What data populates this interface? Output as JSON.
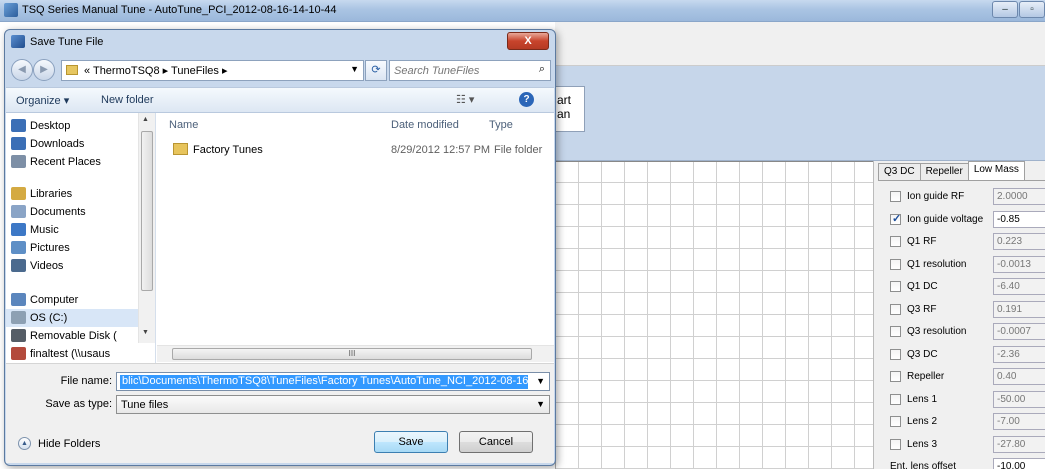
{
  "main_window": {
    "title": "TSQ Series Manual Tune - AutoTune_PCI_2012-08-16-14-10-44",
    "start_scan_label_1": "art",
    "start_scan_label_2": "an"
  },
  "dialog": {
    "title": "Save Tune File",
    "close_glyph": "X",
    "address": {
      "path": "« ThermoTSQ8 ▸ TuneFiles ▸",
      "search_placeholder": "Search TuneFiles"
    },
    "commands": {
      "organize": "Organize ▾",
      "new_folder": "New folder",
      "views_glyph": "☷ ▾",
      "help_glyph": "?"
    },
    "nav_pane": {
      "items": [
        {
          "label": "Desktop",
          "icon": "desktop-icon",
          "color": "#3b6fb6"
        },
        {
          "label": "Downloads",
          "icon": "downloads-icon",
          "color": "#3b6fb6"
        },
        {
          "label": "Recent Places",
          "icon": "recent-places-icon",
          "color": "#7d8fa6"
        },
        {
          "label": "Libraries",
          "icon": "libraries-icon",
          "color": "#d4aa42"
        },
        {
          "label": "Documents",
          "icon": "documents-icon",
          "color": "#8aa4c6"
        },
        {
          "label": "Music",
          "icon": "music-icon",
          "color": "#3d78c6"
        },
        {
          "label": "Pictures",
          "icon": "pictures-icon",
          "color": "#5e8fc6"
        },
        {
          "label": "Videos",
          "icon": "videos-icon",
          "color": "#4b6a8e"
        },
        {
          "label": "Computer",
          "icon": "computer-icon",
          "color": "#5b86bd"
        },
        {
          "label": "OS (C:)",
          "icon": "drive-icon",
          "color": "#8da0b3"
        },
        {
          "label": "Removable Disk (",
          "icon": "removable-disk-icon",
          "color": "#555d66"
        },
        {
          "label": "finaltest (\\\\usaus",
          "icon": "network-drive-icon",
          "color": "#b34a3c"
        }
      ]
    },
    "file_list": {
      "columns": {
        "name": "Name",
        "date_modified": "Date modified",
        "type": "Type"
      },
      "rows": [
        {
          "name": "Factory Tunes",
          "date_modified": "8/29/2012 12:57 PM",
          "type": "File folder"
        }
      ],
      "hscroll_glyph": "III"
    },
    "form": {
      "file_name_label": "File name:",
      "file_name_value": "blic\\Documents\\ThermoTSQ8\\TuneFiles\\Factory Tunes\\AutoTune_NCI_2012-08-16-14-4",
      "save_as_type_label": "Save as type:",
      "save_as_type_value": "Tune files",
      "hide_folders": "Hide Folders",
      "save": "Save",
      "cancel": "Cancel"
    }
  },
  "tune_panel": {
    "tabs": [
      "Q3 DC",
      "Repeller",
      "Low Mass"
    ],
    "active_tab": "Low Mass",
    "params": [
      {
        "label": "Ion guide RF",
        "value": "2.0000",
        "checked": false
      },
      {
        "label": "Ion guide voltage",
        "value": "-0.85",
        "checked": true
      },
      {
        "label": "Q1 RF",
        "value": "0.223",
        "checked": false
      },
      {
        "label": "Q1 resolution",
        "value": "-0.0013",
        "checked": false
      },
      {
        "label": "Q1 DC",
        "value": "-6.40",
        "checked": false
      },
      {
        "label": "Q3 RF",
        "value": "0.191",
        "checked": false
      },
      {
        "label": "Q3 resolution",
        "value": "-0.0007",
        "checked": false
      },
      {
        "label": "Q3 DC",
        "value": "-2.36",
        "checked": false
      },
      {
        "label": "Repeller",
        "value": "0.40",
        "checked": false
      },
      {
        "label": "Lens 1",
        "value": "-50.00",
        "checked": false
      },
      {
        "label": "Lens 2",
        "value": "-7.00",
        "checked": false
      },
      {
        "label": "Lens 3",
        "value": "-27.80",
        "checked": false
      },
      {
        "label": "Ent. lens offset",
        "value": "-10.00",
        "checked": null
      }
    ]
  }
}
